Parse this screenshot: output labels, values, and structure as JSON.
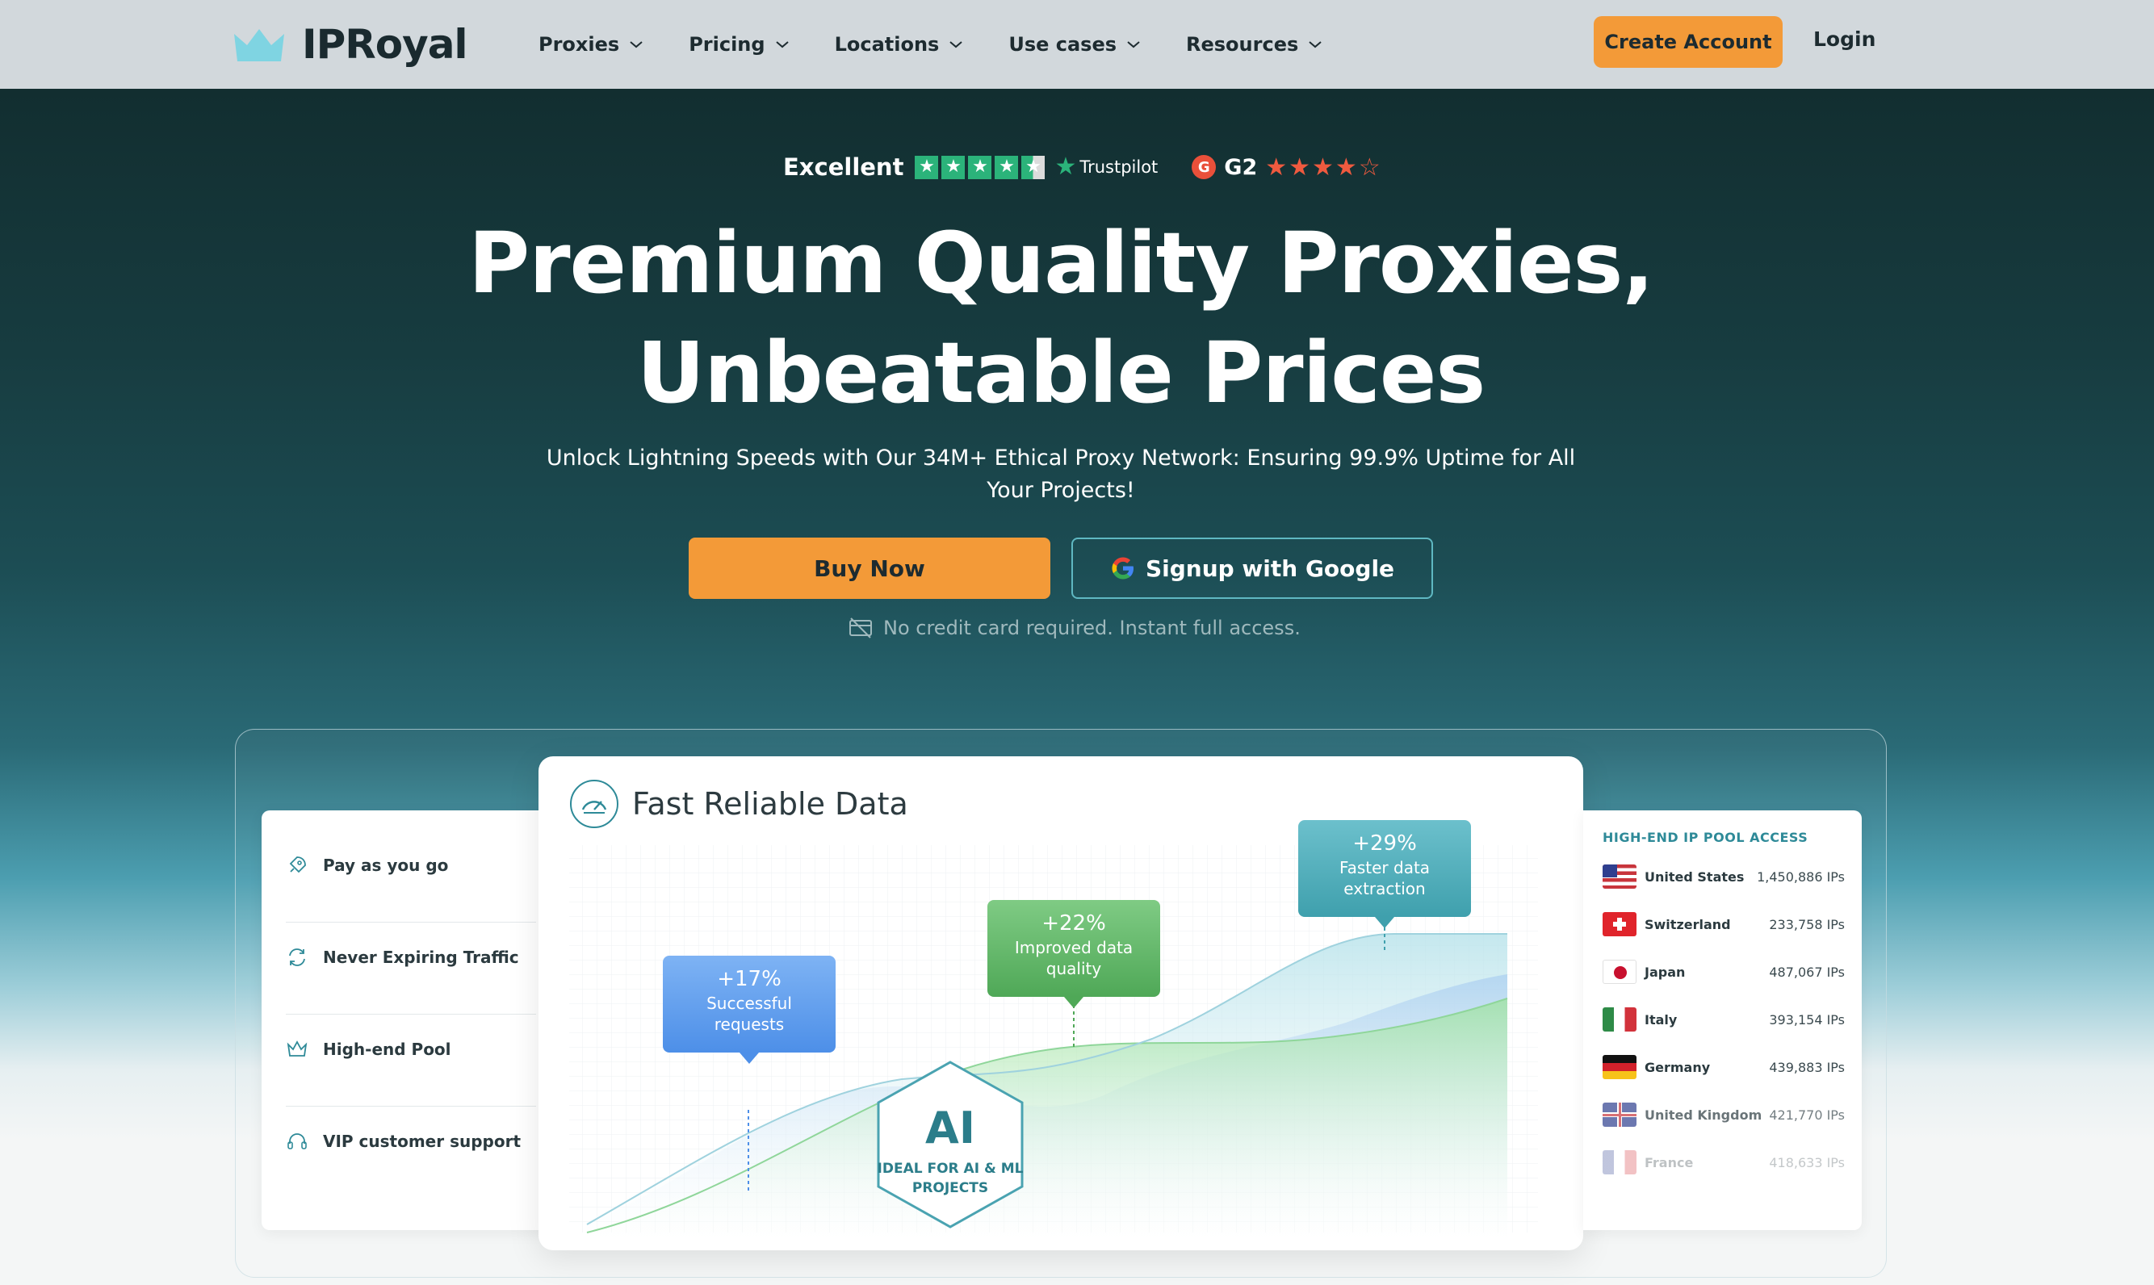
{
  "header": {
    "brand": "IPRoyal",
    "nav": [
      {
        "label": "Proxies"
      },
      {
        "label": "Pricing"
      },
      {
        "label": "Locations"
      },
      {
        "label": "Use cases"
      },
      {
        "label": "Resources"
      }
    ],
    "create_account": "Create Account",
    "login": "Login"
  },
  "ratings": {
    "trustpilot_label": "Excellent",
    "trustpilot_brand": "Trustpilot",
    "trustpilot_stars": 4.5,
    "g2_label": "G2",
    "g2_stars": 4.5
  },
  "hero": {
    "headline_line1": "Premium Quality Proxies,",
    "headline_line2": "Unbeatable Prices",
    "subtext": "Unlock Lightning Speeds with Our 34M+ Ethical Proxy Network: Ensuring 99.9% Uptime for All Your Projects!",
    "buy_now": "Buy Now",
    "google_signup": "Signup with Google",
    "no_card": "No credit card required. Instant full access."
  },
  "features": [
    {
      "label": "Pay as you go",
      "icon": "rocket-icon"
    },
    {
      "label": "Never Expiring Traffic",
      "icon": "refresh-icon"
    },
    {
      "label": "High-end Pool",
      "icon": "crown-icon"
    },
    {
      "label": "VIP customer support",
      "icon": "headset-icon"
    }
  ],
  "card": {
    "title": "Fast Reliable Data",
    "bubbles": [
      {
        "pct": "+17%",
        "label1": "Successful",
        "label2": "requests",
        "color": "#4d8fe8"
      },
      {
        "pct": "+22%",
        "label1": "Improved data",
        "label2": "quality",
        "color": "#4fa857"
      },
      {
        "pct": "+29%",
        "label1": "Faster data",
        "label2": "extraction",
        "color": "#3fa0ad"
      }
    ],
    "hex_big": "AI",
    "hex_line1": "IDEAL FOR AI & ML",
    "hex_line2": "PROJECTS"
  },
  "pool": {
    "title": "HIGH-END IP POOL ACCESS",
    "rows": [
      {
        "country": "United States",
        "count": "1,450,886 IPs"
      },
      {
        "country": "Switzerland",
        "count": "233,758 IPs"
      },
      {
        "country": "Japan",
        "count": "487,067 IPs"
      },
      {
        "country": "Italy",
        "count": "393,154 IPs"
      },
      {
        "country": "Germany",
        "count": "439,883 IPs"
      },
      {
        "country": "United Kingdom",
        "count": "421,770 IPs"
      },
      {
        "country": "France",
        "count": "418,633 IPs"
      }
    ]
  },
  "colors": {
    "accent_orange": "#f39a38",
    "teal": "#2e8a98",
    "trustpilot_green": "#2bb37a",
    "g2_red": "#ef5a3f"
  }
}
